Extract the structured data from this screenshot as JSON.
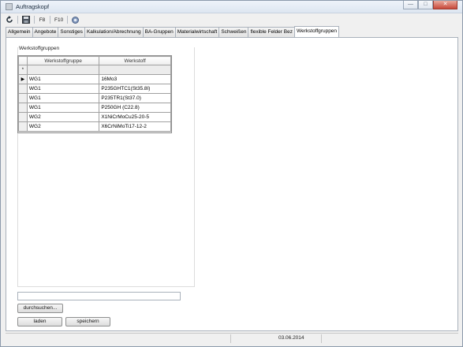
{
  "window": {
    "title": "Auftragskopf",
    "controls": {
      "minimize": "—",
      "maximize": "□",
      "close": "✕"
    }
  },
  "toolbar": {
    "refresh_icon": "refresh-icon",
    "save_icon": "save-icon",
    "f8_label": "F8",
    "f10_label": "F10",
    "help_icon": "help-icon"
  },
  "tabs": [
    {
      "label": "Allgemein"
    },
    {
      "label": "Angebote"
    },
    {
      "label": "Sonstiges"
    },
    {
      "label": "Kalkulation/Abrechnung"
    },
    {
      "label": "BA-Gruppen"
    },
    {
      "label": "Materialwirtschaft"
    },
    {
      "label": "Schweißen"
    },
    {
      "label": "flexible Felder Bez"
    },
    {
      "label": "Werkstoffgruppen",
      "active": true
    }
  ],
  "section": {
    "title": "Werkstoffgruppen"
  },
  "grid": {
    "columns": [
      "Werkstoffgruppe",
      "Werkstoff"
    ],
    "new_row_marker": "*",
    "current_row_marker": "▶",
    "rows": [
      {
        "gruppe": "WG1",
        "werkstoff": "16Mo3"
      },
      {
        "gruppe": "WG1",
        "werkstoff": "P235GHTC1(St35.8I)"
      },
      {
        "gruppe": "WG1",
        "werkstoff": "P235TR1(St37.0)"
      },
      {
        "gruppe": "WG1",
        "werkstoff": "P250GH (C22.8)"
      },
      {
        "gruppe": "WG2",
        "werkstoff": "X1NiCrMoCu25-20-5"
      },
      {
        "gruppe": "WG2",
        "werkstoff": "X6CrNiMoTi17-12-2"
      }
    ]
  },
  "search": {
    "value": ""
  },
  "buttons": {
    "browse": "durchsuchen...",
    "load": "laden",
    "save": "speichern"
  },
  "status": {
    "date": "03.06.2014"
  }
}
